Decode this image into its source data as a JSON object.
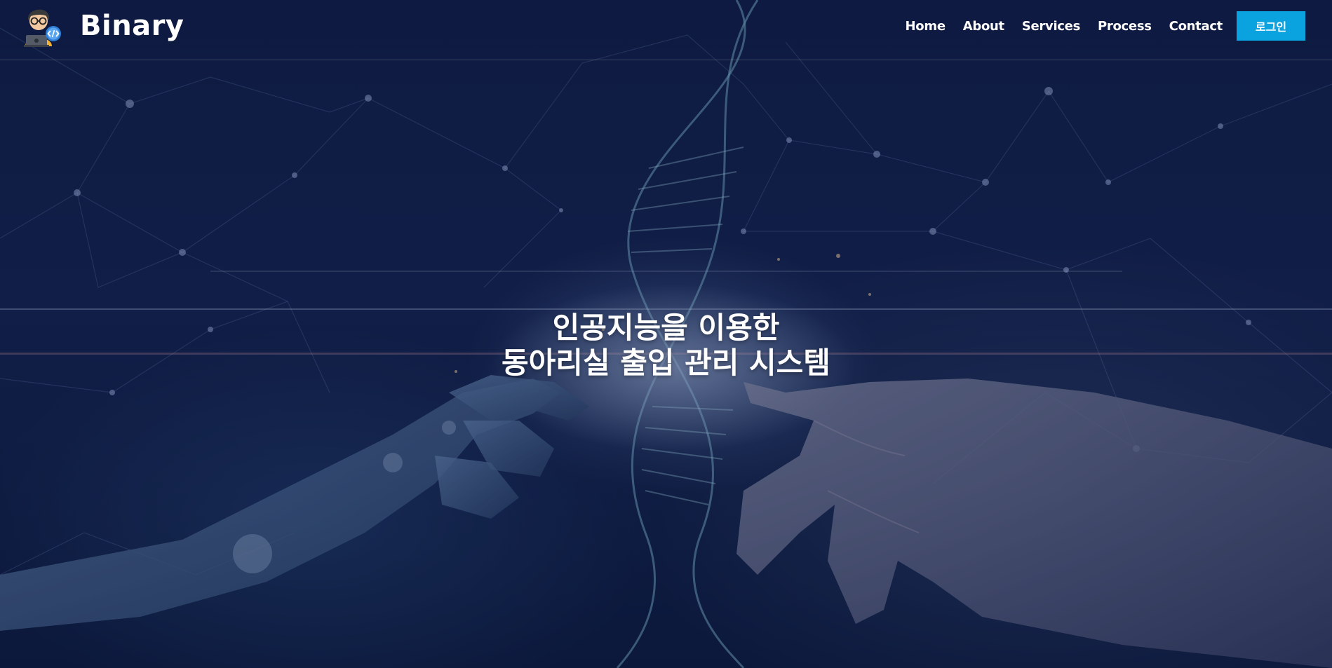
{
  "brand": {
    "name": "Binary",
    "logo_icon": "developer-avatar-icon"
  },
  "nav": {
    "items": [
      {
        "label": "Home"
      },
      {
        "label": "About"
      },
      {
        "label": "Services"
      },
      {
        "label": "Process"
      },
      {
        "label": "Contact"
      }
    ],
    "login_label": "로그인"
  },
  "hero": {
    "title_line1": "인공지능을 이용한",
    "title_line2": "동아리실 출입 관리 시스템",
    "background": "ai-hand-dna-network-image"
  },
  "colors": {
    "accent": "#0aa3e0",
    "background": "#0f1d44",
    "text": "#ffffff"
  }
}
